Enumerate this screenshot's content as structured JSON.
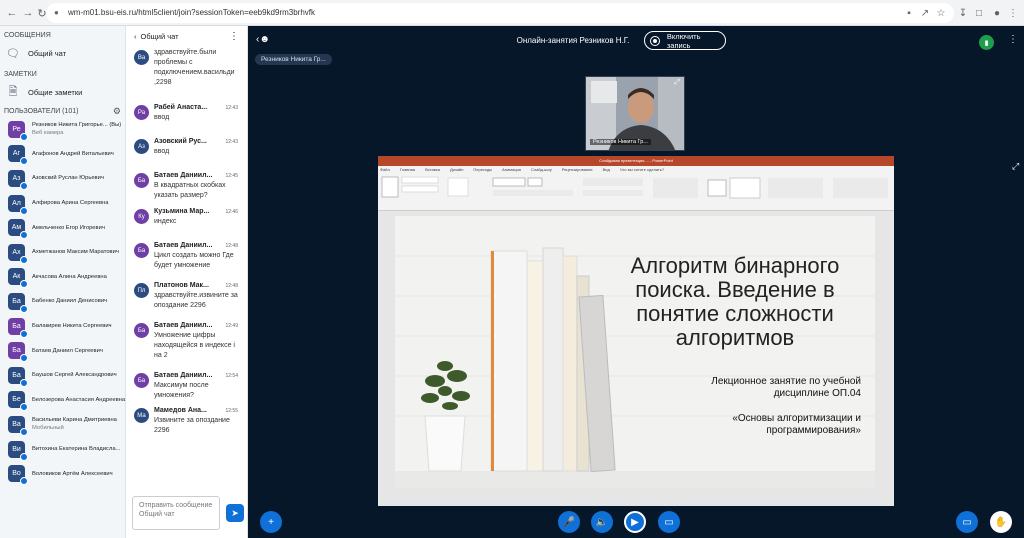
{
  "browser": {
    "url": "wm-m01.bsu-eis.ru/html5client/join?sessionToken=eeb9kd9rm3brhvfk"
  },
  "sidebar": {
    "messages_section": "СООБЩЕНИЯ",
    "public_chat": "Общий чат",
    "notes_section": "ЗАМЕТКИ",
    "shared_notes": "Общие заметки",
    "users_section": "ПОЛЬЗОВАТЕЛИ (101)",
    "users": [
      {
        "initials": "Ре",
        "name": "Резников Никита Григорье... (Вы)",
        "sub": "Веб камера",
        "color": "#6f3fa6"
      },
      {
        "initials": "Аг",
        "name": "Агафонов Андрей Витальевич",
        "color": "#2b4c80"
      },
      {
        "initials": "Аз",
        "name": "Азовский Руслан Юрьевич",
        "color": "#2b4c80"
      },
      {
        "initials": "Ал",
        "name": "Алфирова Арина Сергеевна",
        "color": "#2b4c80"
      },
      {
        "initials": "Ам",
        "name": "Амельченко Егор Игоревич",
        "color": "#2b4c80"
      },
      {
        "initials": "Ах",
        "name": "Ахметжанов Максим Маратович",
        "color": "#2b4c80"
      },
      {
        "initials": "Ак",
        "name": "Акчасова Алина Андреевна",
        "color": "#2b4c80"
      },
      {
        "initials": "Ба",
        "name": "Бабенко Даниил Денисович",
        "color": "#2b4c80"
      },
      {
        "initials": "Ба",
        "name": "Балакирев Никита Сергеевич",
        "color": "#6f3fa6"
      },
      {
        "initials": "Ба",
        "name": "Батаев Даниил Сергеевич",
        "color": "#6f3fa6"
      },
      {
        "initials": "Ба",
        "name": "Баушов Сергей Александрович",
        "color": "#2b4c80"
      },
      {
        "initials": "Бе",
        "name": "Белозерова Анастасия Андреевна",
        "color": "#2b4c80"
      },
      {
        "initials": "Ва",
        "name": "Васильеви Карина Дмитриевна",
        "sub": "Мобильный",
        "color": "#2b4c80"
      },
      {
        "initials": "Ви",
        "name": "Витохина Екатерина Владисла...",
        "color": "#2b4c80"
      },
      {
        "initials": "Во",
        "name": "Воловиков Артём Алексеевич",
        "color": "#2b4c80"
      }
    ]
  },
  "chat": {
    "title": "Общий чат",
    "input_placeholder": "Отправить сообщение Общий чат",
    "messages": [
      {
        "initials": "Ва",
        "name": "",
        "time": "",
        "text": "здравствуйте.были проблемы с подключением.васильди ,2298",
        "color": "#2b4c80"
      },
      {
        "initials": "Ра",
        "name": "Рабей Анаста...",
        "time": "12:43",
        "text": "ввод",
        "color": "#6f3fa6"
      },
      {
        "initials": "Аз",
        "name": "Азовский Рус...",
        "time": "12:43",
        "text": "ввод",
        "color": "#2b4c80"
      },
      {
        "initials": "Ба",
        "name": "Батаев Даниил...",
        "time": "12:45",
        "text": "В квадратных скобках указать размер?",
        "color": "#6f3fa6"
      },
      {
        "initials": "Ку",
        "name": "Кузьмина Мар...",
        "time": "12:46",
        "text": "индекс",
        "color": "#6f3fa6"
      },
      {
        "initials": "Ба",
        "name": "Батаев Даниил...",
        "time": "12:48",
        "text": "Цикл создать можно Где будет умножение",
        "color": "#6f3fa6"
      },
      {
        "initials": "Пл",
        "name": "Платонов Мак...",
        "time": "12:48",
        "text": "здравствуйте.извините за опоздание 2296",
        "color": "#2b4c80"
      },
      {
        "initials": "Ба",
        "name": "Батаев Даниил...",
        "time": "12:49",
        "text": "Умножение цифры находящейся в индексе i на 2",
        "color": "#6f3fa6"
      },
      {
        "initials": "Ба",
        "name": "Батаев Даниил...",
        "time": "12:54",
        "text": "Максимум после умножения?",
        "color": "#6f3fa6"
      },
      {
        "initials": "Ма",
        "name": "Мамедов Ана...",
        "time": "12:55",
        "text": "Извините за опоздание 2296",
        "color": "#2b4c80"
      }
    ]
  },
  "main": {
    "meeting_title": "Онлайн-занятия Резников Н.Г.",
    "record_label": "Включить запись",
    "talker": "Резников Никита Гр...",
    "cam_label": "Резников Никита Гр...",
    "slide": {
      "title": "Алгоритм бинарного поиска. Введение в понятие сложности алгоритмов",
      "subtitle": "Лекционное занятие по учебной дисциплине ОП.04",
      "course": "«Основы алгоритмизации и программирования»",
      "ppt_title": "Слайдовая презентация ... - PowerPoint",
      "ribbon_tabs": [
        "Файл",
        "Главная",
        "Вставка",
        "Дизайн",
        "Переходы",
        "Анимация",
        "Слайд-шоу",
        "Рецензирование",
        "Вид",
        "Что вы хотите сделать?"
      ]
    }
  },
  "colors": {
    "accent": "#0f70d7",
    "main_bg": "#06172a"
  }
}
